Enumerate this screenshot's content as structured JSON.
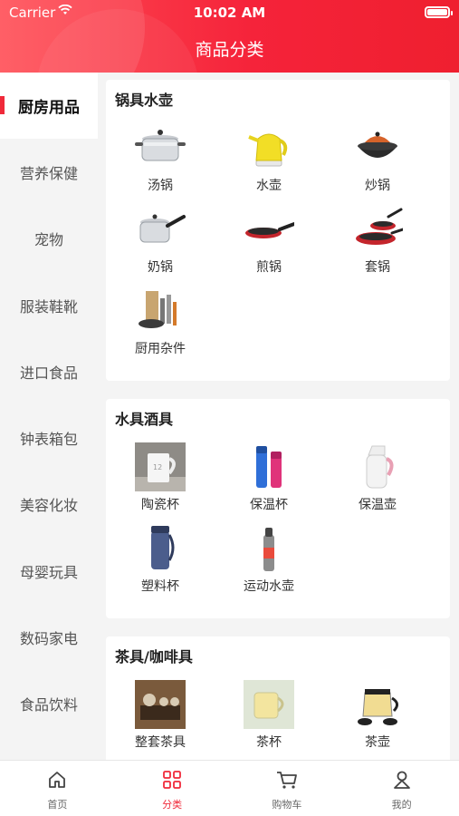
{
  "status_bar": {
    "carrier": "Carrier",
    "time": "10:02 AM",
    "wifi_icon": "wifi-icon",
    "battery_icon": "battery-icon"
  },
  "nav": {
    "title": "商品分类"
  },
  "colors": {
    "accent": "#f02a3a",
    "header_start": "#ff4d55",
    "header_end": "#ef1f2f"
  },
  "sidebar": {
    "active": 0,
    "items": [
      {
        "label": "厨房用品"
      },
      {
        "label": "营养保健"
      },
      {
        "label": "宠物"
      },
      {
        "label": "服装鞋靴"
      },
      {
        "label": "进口食品"
      },
      {
        "label": "钟表箱包"
      },
      {
        "label": "美容化妆"
      },
      {
        "label": "母婴玩具"
      },
      {
        "label": "数码家电"
      },
      {
        "label": "食品饮料"
      }
    ]
  },
  "sections": [
    {
      "title": "锅具水壶",
      "items": [
        {
          "label": "汤锅",
          "icon": "soup-pot-icon"
        },
        {
          "label": "水壶",
          "icon": "kettle-icon"
        },
        {
          "label": "炒锅",
          "icon": "wok-icon"
        },
        {
          "label": "奶锅",
          "icon": "milk-pan-icon"
        },
        {
          "label": "煎锅",
          "icon": "frying-pan-icon"
        },
        {
          "label": "套锅",
          "icon": "pot-set-icon"
        },
        {
          "label": "厨用杂件",
          "icon": "kitchen-tools-icon"
        }
      ]
    },
    {
      "title": "水具酒具",
      "items": [
        {
          "label": "陶瓷杯",
          "icon": "ceramic-mug-icon"
        },
        {
          "label": "保温杯",
          "icon": "thermos-cup-icon"
        },
        {
          "label": "保温壶",
          "icon": "thermos-pot-icon"
        },
        {
          "label": "塑料杯",
          "icon": "plastic-cup-icon"
        },
        {
          "label": "运动水壶",
          "icon": "sport-bottle-icon"
        }
      ]
    },
    {
      "title": "茶具/咖啡具",
      "items": [
        {
          "label": "整套茶具",
          "icon": "tea-set-icon"
        },
        {
          "label": "茶杯",
          "icon": "tea-cup-icon"
        },
        {
          "label": "茶壶",
          "icon": "teapot-icon"
        },
        {
          "label": "",
          "icon": "coffee-machine-icon"
        }
      ]
    }
  ],
  "tabbar": {
    "active": 1,
    "items": [
      {
        "label": "首页",
        "icon": "home-icon"
      },
      {
        "label": "分类",
        "icon": "category-icon"
      },
      {
        "label": "购物车",
        "icon": "cart-icon"
      },
      {
        "label": "我的",
        "icon": "user-icon"
      }
    ]
  }
}
